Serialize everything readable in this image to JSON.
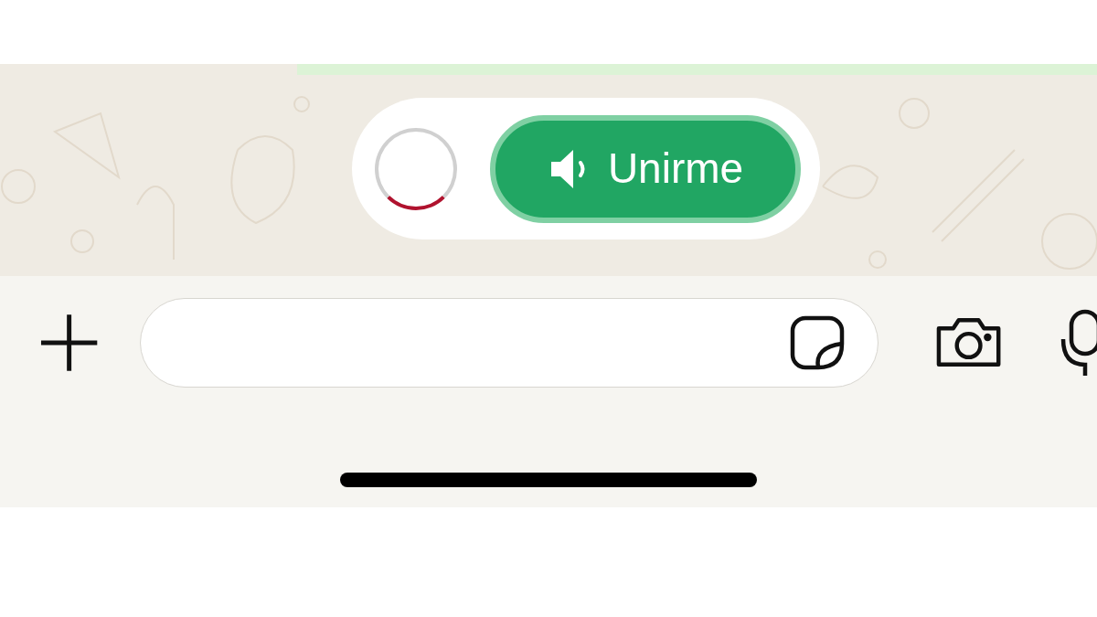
{
  "voice_chat_banner": {
    "join_label": "Unirme"
  }
}
